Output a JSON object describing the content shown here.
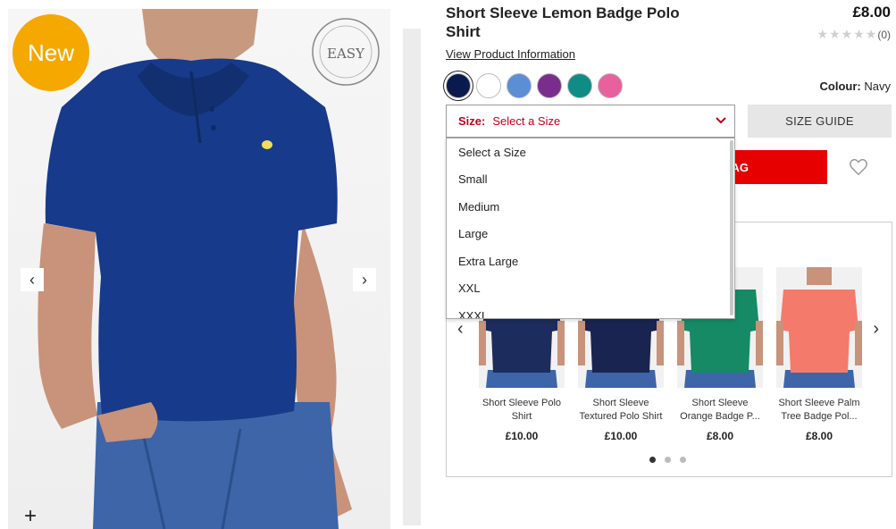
{
  "product": {
    "title": "Short Sleeve Lemon Badge Polo Shirt",
    "price": "£8.00",
    "rating_count": "(0)",
    "rating_stars": 0,
    "view_info_label": "View Product Information",
    "new_badge": "New",
    "brand_logo_text": "EASY"
  },
  "colours": {
    "label": "Colour:",
    "selected": "Navy",
    "swatches": [
      {
        "name": "Navy",
        "hex": "#0a1a4f"
      },
      {
        "name": "White",
        "hex": "#ffffff"
      },
      {
        "name": "Blue",
        "hex": "#5a8fd6"
      },
      {
        "name": "Purple",
        "hex": "#7b2d8f"
      },
      {
        "name": "Teal",
        "hex": "#0e8c85"
      },
      {
        "name": "Pink",
        "hex": "#e8609e"
      }
    ]
  },
  "size": {
    "label": "Size:",
    "placeholder": "Select a Size",
    "guide_label": "SIZE GUIDE",
    "options": [
      "Select a Size",
      "Small",
      "Medium",
      "Large",
      "Extra Large",
      "XXL",
      "XXXL"
    ]
  },
  "bag": {
    "label": "AG"
  },
  "recommendations": [
    {
      "name": "Short Sleeve Polo Shirt",
      "price": "£10.00",
      "shirt": "#1c2c5c"
    },
    {
      "name": "Short Sleeve Textured Polo Shirt",
      "price": "£10.00",
      "shirt": "#1a2450"
    },
    {
      "name": "Short Sleeve Orange Badge P...",
      "price": "£8.00",
      "shirt": "#158a64"
    },
    {
      "name": "Short Sleeve Palm Tree Badge Pol...",
      "price": "£8.00",
      "shirt": "#f47a6b"
    }
  ],
  "colors": {
    "accent_red": "#e60000",
    "size_text": "#c0001a",
    "badge_orange": "#f5a800",
    "main_shirt": "#173a8a"
  }
}
